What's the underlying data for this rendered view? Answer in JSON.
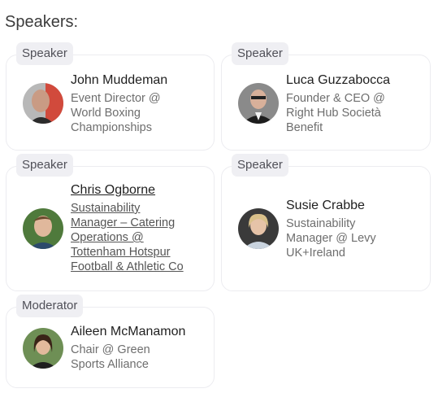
{
  "heading": "Speakers:",
  "cards": [
    {
      "badge": "Speaker",
      "name": "John Muddeman",
      "role_lines": [
        "Event Director @",
        "World Boxing",
        "Championships"
      ]
    },
    {
      "badge": "Speaker",
      "name": "Luca Guzzabocca",
      "role_lines": [
        "Founder & CEO @",
        "Right Hub Società",
        "Benefit"
      ]
    },
    {
      "badge": "Speaker",
      "name": "Chris Ogborne",
      "role_lines": [
        "Sustainability",
        "Manager – Catering",
        "Operations @",
        "Tottenham Hotspur",
        "Football & Athletic Co"
      ]
    },
    {
      "badge": "Speaker",
      "name": "Susie Crabbe",
      "role_lines": [
        "Sustainability",
        "Manager @ Levy",
        "UK+Ireland"
      ]
    },
    {
      "badge": "Moderator",
      "name": "Aileen McManamon",
      "role_lines": [
        "Chair @ Green",
        "Sports Alliance"
      ]
    }
  ]
}
